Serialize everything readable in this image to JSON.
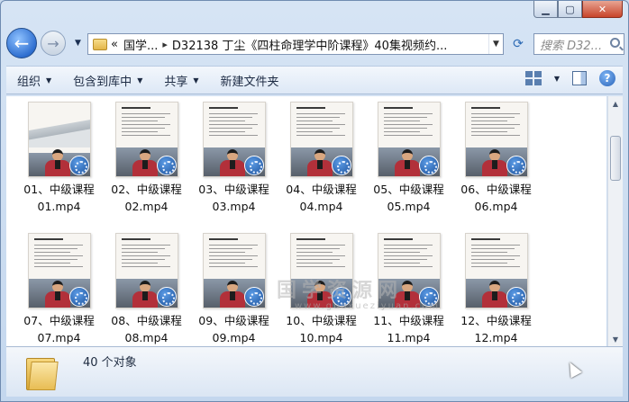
{
  "window": {
    "minimize_icon": "minimize-icon",
    "maximize_icon": "maximize-icon",
    "close_icon": "close-icon"
  },
  "nav": {
    "address_prefix": "«",
    "address_crumb": "国学...",
    "address_separator": "▸",
    "address_path": "D32138 丁尘《四柱命理学中阶课程》40集视频约...",
    "search_placeholder": "搜索 D32..."
  },
  "toolbar": {
    "organize": "组织",
    "include_in_library": "包含到库中",
    "share": "共享",
    "new_folder": "新建文件夹"
  },
  "files": [
    {
      "name": "01、中级课程\n01.mp4",
      "style": "title"
    },
    {
      "name": "02、中级课程\n02.mp4",
      "style": "slide"
    },
    {
      "name": "03、中级课程\n03.mp4",
      "style": "slide"
    },
    {
      "name": "04、中级课程\n04.mp4",
      "style": "slide"
    },
    {
      "name": "05、中级课程\n05.mp4",
      "style": "slide"
    },
    {
      "name": "06、中级课程\n06.mp4",
      "style": "slide"
    },
    {
      "name": "07、中级课程\n07.mp4",
      "style": "slide"
    },
    {
      "name": "08、中级课程\n08.mp4",
      "style": "slide"
    },
    {
      "name": "09、中级课程\n09.mp4",
      "style": "slide"
    },
    {
      "name": "10、中级课程\n10.mp4",
      "style": "slide"
    },
    {
      "name": "11、中级课程\n11.mp4",
      "style": "slide"
    },
    {
      "name": "12、中级课程\n12.mp4",
      "style": "slide"
    }
  ],
  "watermark": {
    "text": "国学资源网",
    "url": "www.guoxueziyuan.com"
  },
  "details": {
    "count": "40 个对象"
  }
}
